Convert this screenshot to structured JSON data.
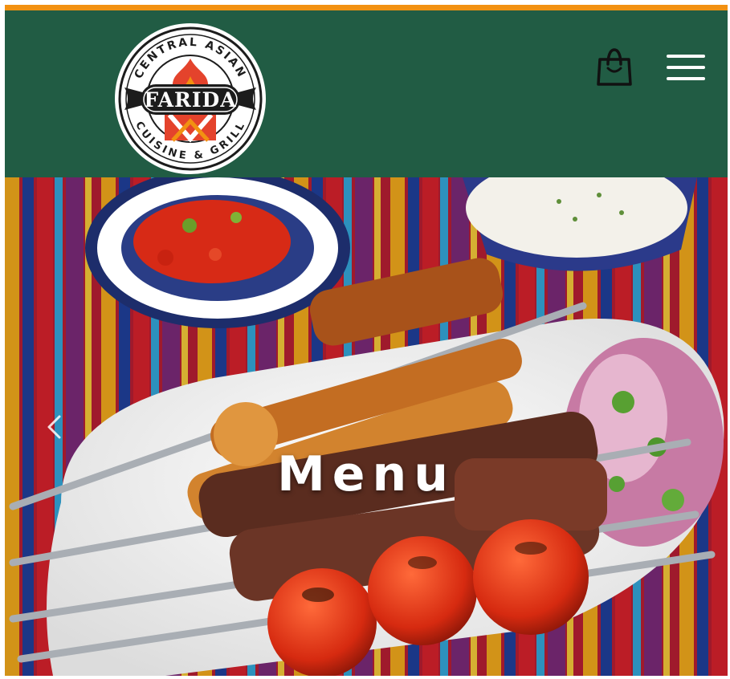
{
  "header": {
    "logo": {
      "name": "FARIDA",
      "arc_top": "CENTRAL ASIAN",
      "arc_bottom": "CUISINE & GRILL"
    },
    "cart_icon": "shopping-bag-icon",
    "menu_icon": "hamburger-menu-icon"
  },
  "hero": {
    "title": "Menu",
    "prev_icon": "chevron-left-icon"
  },
  "colors": {
    "accent": "#f29111",
    "header_bg": "#215c44",
    "hero_text": "#ffffff"
  }
}
